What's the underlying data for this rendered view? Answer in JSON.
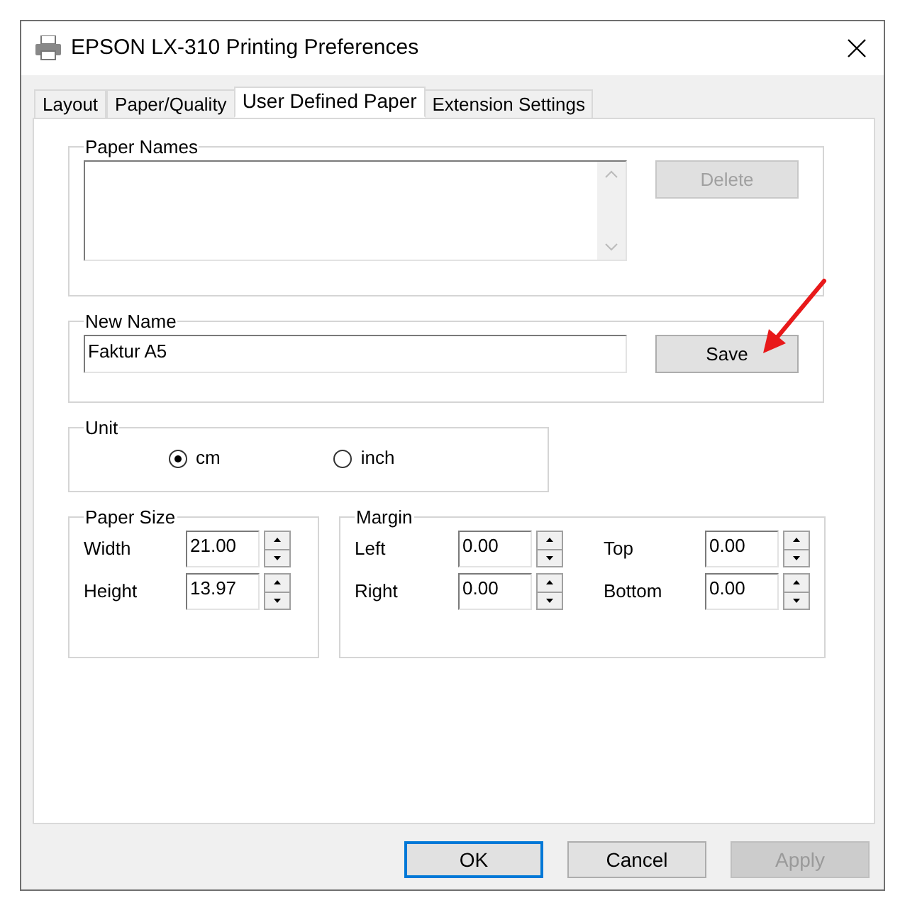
{
  "window": {
    "title": "EPSON LX-310 Printing Preferences"
  },
  "tabs": [
    {
      "label": "Layout",
      "selected": false
    },
    {
      "label": "Paper/Quality",
      "selected": false
    },
    {
      "label": "User Defined Paper",
      "selected": true
    },
    {
      "label": "Extension Settings",
      "selected": false
    }
  ],
  "paper_names": {
    "label": "Paper Names",
    "delete_button": {
      "label": "Delete",
      "disabled": true
    }
  },
  "new_name": {
    "label": "New Name",
    "value": "Faktur A5",
    "save_button": {
      "label": "Save",
      "disabled": false
    }
  },
  "unit": {
    "label": "Unit",
    "options": [
      {
        "label": "cm",
        "selected": true
      },
      {
        "label": "inch",
        "selected": false
      }
    ]
  },
  "paper_size": {
    "label": "Paper Size",
    "fields": [
      {
        "label": "Width",
        "value": "21.00"
      },
      {
        "label": "Height",
        "value": "13.97"
      }
    ]
  },
  "margin": {
    "label": "Margin",
    "fields": [
      {
        "label": "Left",
        "value": "0.00"
      },
      {
        "label": "Top",
        "value": "0.00"
      },
      {
        "label": "Right",
        "value": "0.00"
      },
      {
        "label": "Bottom",
        "value": "0.00"
      }
    ]
  },
  "buttons": [
    {
      "label": "OK",
      "default": true,
      "disabled": false
    },
    {
      "label": "Cancel",
      "default": false,
      "disabled": false
    },
    {
      "label": "Apply",
      "default": false,
      "disabled": true
    }
  ]
}
